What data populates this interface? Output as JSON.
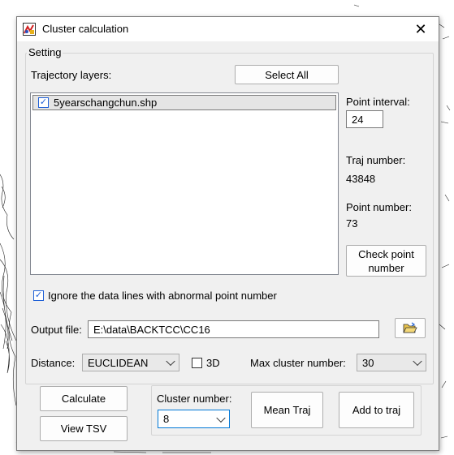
{
  "window": {
    "title": "Cluster calculation",
    "close_glyph": "✕"
  },
  "setting": {
    "group_label": "Setting",
    "trajectory_label": "Trajectory layers:",
    "select_all_label": "Select All",
    "layers": [
      {
        "name": "5yearschangchun.shp",
        "checked": true
      }
    ],
    "point_interval_label": "Point interval:",
    "point_interval_value": "24",
    "traj_number_label": "Traj number:",
    "traj_number_value": "43848",
    "point_number_label": "Point number:",
    "point_number_value": "73",
    "check_point_label": "Check point number",
    "ignore_label": "Ignore the data lines with abnormal point number",
    "ignore_checked": true,
    "output_label": "Output file:",
    "output_value": "E:\\data\\BACKTCC\\CC16",
    "distance_label": "Distance:",
    "distance_value": "EUCLIDEAN",
    "threed_label": "3D",
    "threed_checked": false,
    "max_cluster_label": "Max cluster number:",
    "max_cluster_value": "30"
  },
  "actions": {
    "calculate_label": "Calculate",
    "view_tsv_label": "View TSV",
    "cluster_number_label": "Cluster number:",
    "cluster_number_value": "8",
    "mean_traj_label": "Mean Traj",
    "add_to_traj_label": "Add to traj"
  },
  "colors": {
    "accent": "#1e5fd6",
    "focus": "#0078d7"
  }
}
